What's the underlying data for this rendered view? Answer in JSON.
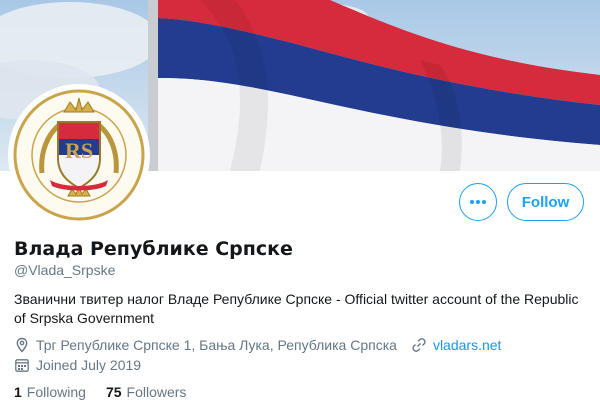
{
  "profile": {
    "name": "Влада Републике Српске",
    "handle": "@Vlada_Srpske",
    "bio": "Званични твитер налог Владе Републике Српске - Official twitter account of the Republic of Srpska Government",
    "location": "Трг Републике Српске 1, Бања Лука, Република Српска",
    "website": "vladars.net",
    "joined": "Joined July 2019"
  },
  "avatar": {
    "seal_text": "РЕПУБЛИКА СРПСКА REPUBLIKA SRPSKA",
    "monogram": "RS"
  },
  "actions": {
    "more_label": "•••",
    "follow_label": "Follow"
  },
  "stats": {
    "following_count": "1",
    "following_label": "Following",
    "followers_count": "75",
    "followers_label": "Followers"
  },
  "colors": {
    "accent": "#1da1f2",
    "flag_red": "#d52b3c",
    "flag_blue": "#233c8f",
    "flag_white": "#f4f4f6",
    "muted_text": "#657786"
  },
  "icons": {
    "location": "location-pin-icon",
    "website": "link-icon",
    "joined": "calendar-icon",
    "more": "more-dots-icon"
  }
}
